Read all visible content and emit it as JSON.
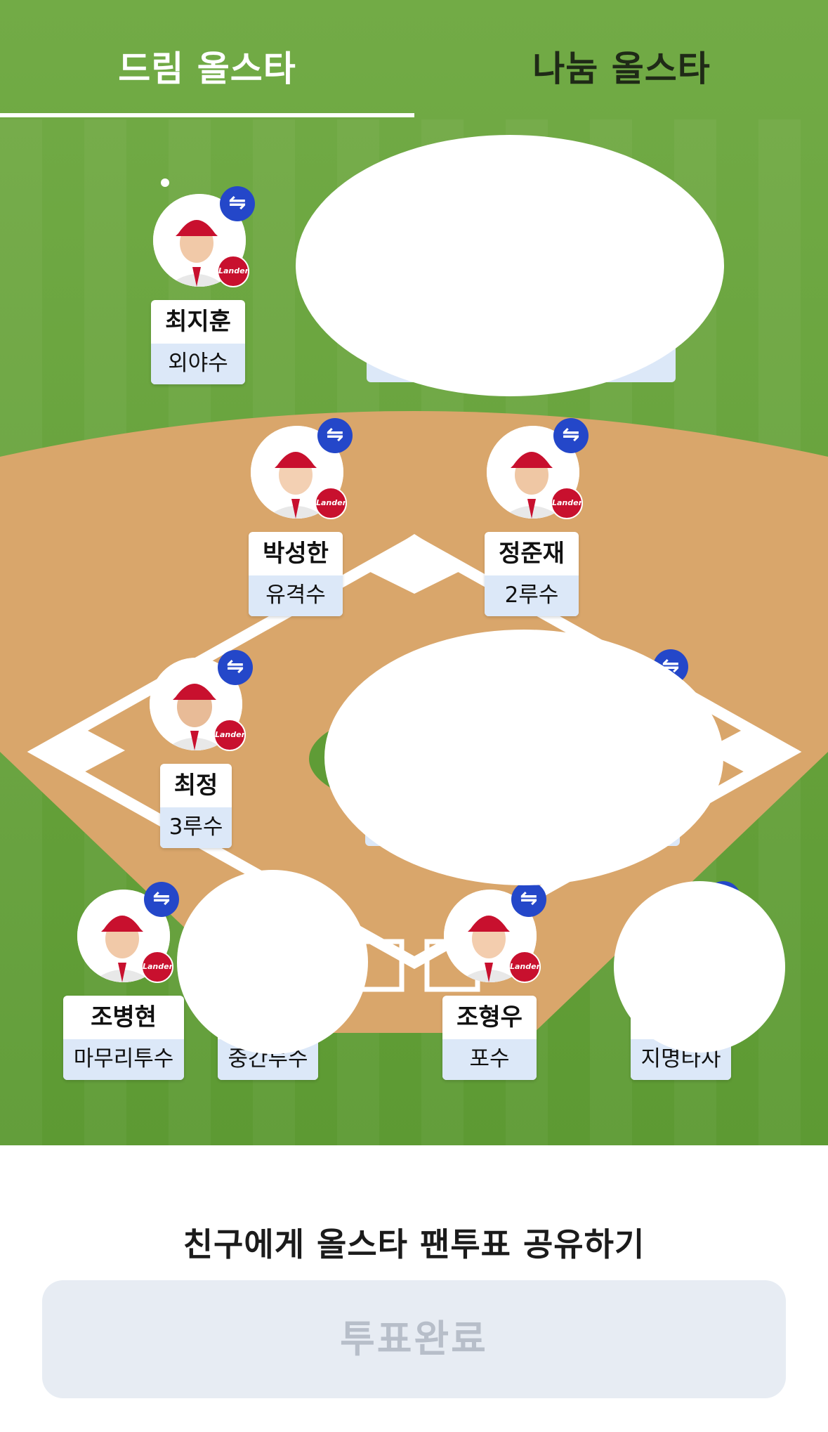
{
  "tabs": [
    {
      "label": "드림 올스타",
      "active": true
    },
    {
      "label": "나눔 올스타",
      "active": false
    }
  ],
  "colors": {
    "grass": "#6aa63c",
    "infield_dirt": "#d9a66b",
    "swap_button": "#2447c9",
    "team_badge": "#c8102e",
    "position_bg": "#dce8f8",
    "vote_button_bg": "#e7ecf3",
    "vote_button_text": "#b7bec9"
  },
  "swap_icon": "⇋",
  "team_badge_text": "Landers",
  "players": [
    {
      "id": "lf",
      "name": "최지훈",
      "position": "외야수"
    },
    {
      "id": "ss",
      "name": "박성한",
      "position": "유격수"
    },
    {
      "id": "2b",
      "name": "정준재",
      "position": "2루수"
    },
    {
      "id": "3b",
      "name": "최정",
      "position": "3루수"
    },
    {
      "id": "cl",
      "name": "조병현",
      "position": "마무리투수"
    },
    {
      "id": "c",
      "name": "조형우",
      "position": "포수"
    },
    {
      "id": "rp_partial",
      "name": "",
      "position": "중간투수"
    },
    {
      "id": "dh_partial",
      "name": "",
      "position": "지명타자"
    }
  ],
  "share_text": "친구에게 올스타 팬투표 공유하기",
  "vote_button_label": "투표완료"
}
